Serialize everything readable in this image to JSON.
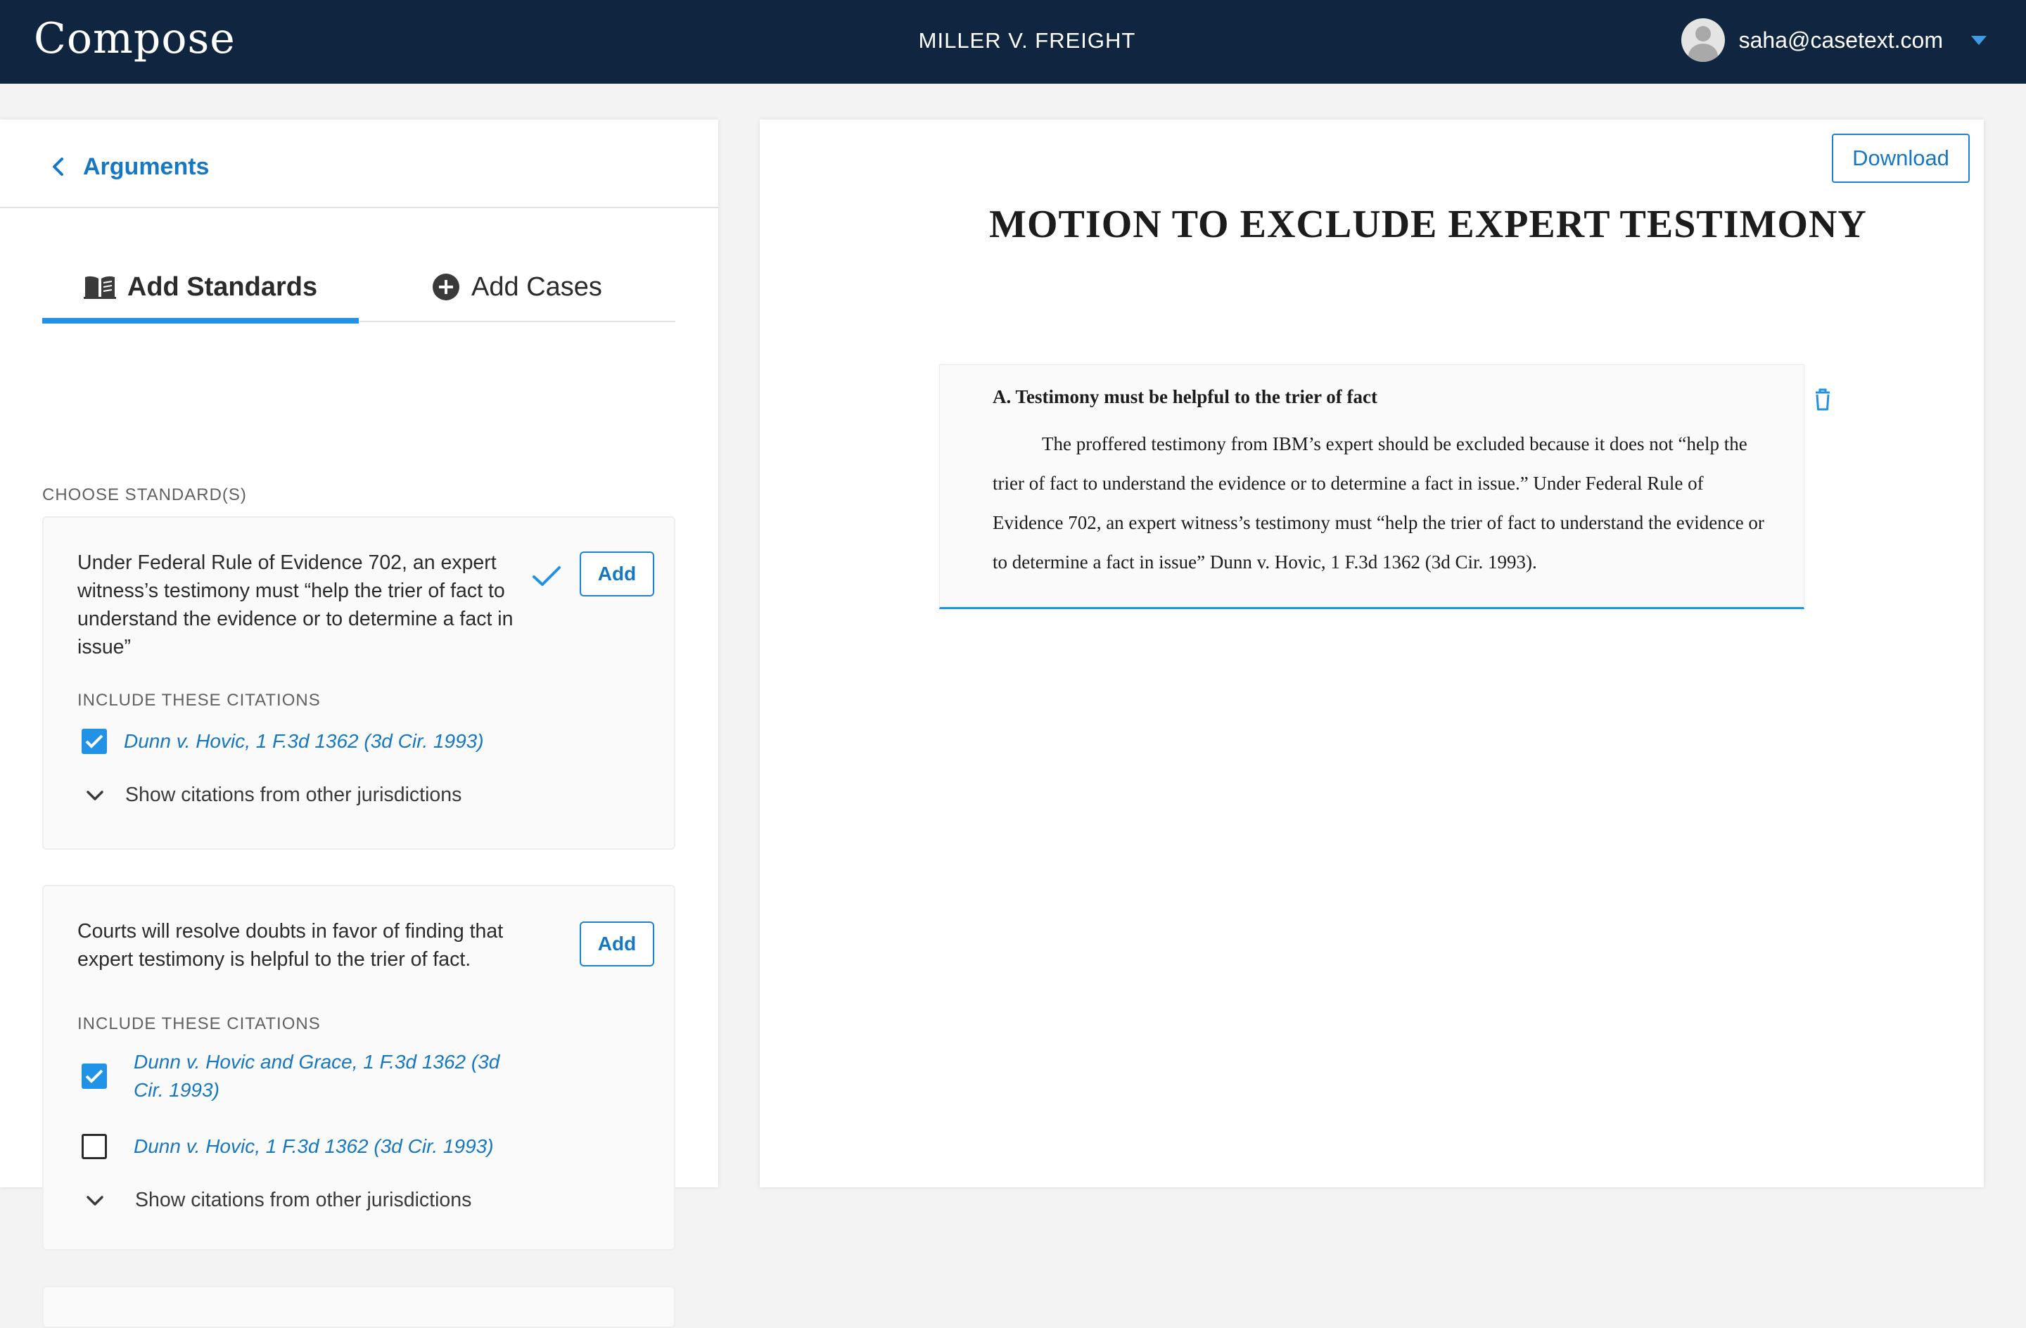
{
  "header": {
    "brand": "Compose",
    "case_title": "MILLER V. FREIGHT",
    "user_email": "saha@casetext.com",
    "avatar_icon": "user-avatar-icon",
    "menu_icon": "caret-down-icon"
  },
  "left_panel": {
    "back_label": "Arguments",
    "back_icon": "chevron-left-icon",
    "tabs": [
      {
        "label": "Add Standards",
        "icon": "book-icon",
        "active": true
      },
      {
        "label": "Add Cases",
        "icon": "plus-circle-icon",
        "active": false
      }
    ],
    "section_label": "CHOOSE STANDARD(S)",
    "standards": [
      {
        "text": "Under Federal Rule of Evidence 702, an expert witness’s testimony must “help the trier of fact to understand the evidence or to determine a fact in issue”",
        "added": true,
        "add_label": "Add",
        "citations_label": "INCLUDE THESE CITATIONS",
        "citations": [
          {
            "text": "Dunn v. Hovic, 1 F.3d 1362 (3d Cir. 1993)",
            "checked": true
          }
        ],
        "show_more_label": "Show citations from other jurisdictions"
      },
      {
        "text": "Courts will resolve doubts in favor of finding that expert testimony is helpful to the trier of fact.",
        "added": false,
        "add_label": "Add",
        "citations_label": "INCLUDE THESE CITATIONS",
        "citations": [
          {
            "text": "Dunn v. Hovic and Grace, 1 F.3d 1362 (3d Cir. 1993)",
            "checked": true
          },
          {
            "text": "Dunn v. Hovic, 1 F.3d 1362 (3d Cir. 1993)",
            "checked": false
          }
        ],
        "show_more_label": "Show citations from other jurisdictions"
      }
    ]
  },
  "document": {
    "download_label": "Download",
    "title": "MOTION TO EXCLUDE EXPERT TESTIMONY",
    "section_heading": "A. Testimony must be helpful to the trier of fact",
    "section_body": "The proffered testimony from IBM’s expert should be excluded because it does not “help the trier of fact to understand the evidence or to determine a fact in issue.” Under Federal Rule of Evidence 702, an expert witness’s testimony must “help the trier of fact to understand the evidence or to determine a fact in issue” Dunn v. Hovic, 1 F.3d 1362 (3d Cir. 1993).",
    "delete_icon": "trash-icon"
  },
  "colors": {
    "header_bg": "#0f2540",
    "accent": "#2193e6",
    "link": "#1677c2"
  }
}
